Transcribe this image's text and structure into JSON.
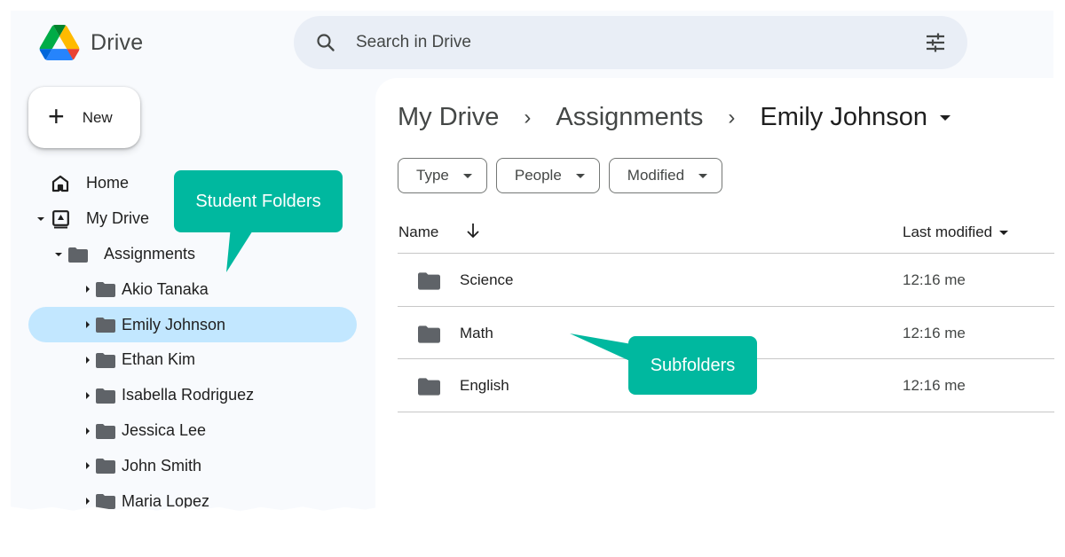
{
  "app": {
    "name": "Drive",
    "logo_icon": "google-drive-logo"
  },
  "search": {
    "placeholder": "Search in Drive",
    "search_icon": "search-icon",
    "options_icon": "tune-icon"
  },
  "new_button": {
    "label": "New",
    "icon": "plus-icon"
  },
  "sidebar": {
    "items": [
      {
        "label": "Home",
        "icon": "home-icon",
        "depth": 0,
        "caret": "none",
        "selected": false
      },
      {
        "label": "My Drive",
        "icon": "my-drive-icon",
        "depth": 0,
        "caret": "expanded",
        "selected": false
      },
      {
        "label": "Assignments",
        "icon": "folder-icon",
        "depth": 1,
        "caret": "expanded",
        "selected": false
      },
      {
        "label": "Akio Tanaka",
        "icon": "folder-icon",
        "depth": 2,
        "caret": "collapsed",
        "selected": false
      },
      {
        "label": "Emily Johnson",
        "icon": "folder-icon",
        "depth": 2,
        "caret": "collapsed",
        "selected": true
      },
      {
        "label": "Ethan Kim",
        "icon": "folder-icon",
        "depth": 2,
        "caret": "collapsed",
        "selected": false
      },
      {
        "label": "Isabella Rodriguez",
        "icon": "folder-icon",
        "depth": 2,
        "caret": "collapsed",
        "selected": false
      },
      {
        "label": "Jessica Lee",
        "icon": "folder-icon",
        "depth": 2,
        "caret": "collapsed",
        "selected": false
      },
      {
        "label": "John Smith",
        "icon": "folder-icon",
        "depth": 2,
        "caret": "collapsed",
        "selected": false
      },
      {
        "label": "Maria Lopez",
        "icon": "folder-icon",
        "depth": 2,
        "caret": "collapsed",
        "selected": false
      }
    ]
  },
  "breadcrumb": {
    "items": [
      "My Drive",
      "Assignments",
      "Emily Johnson"
    ],
    "separator": "›"
  },
  "filters": {
    "chips": [
      "Type",
      "People",
      "Modified"
    ]
  },
  "file_list": {
    "columns": {
      "name": "Name",
      "name_sort": "descending",
      "last_modified": "Last modified"
    },
    "rows": [
      {
        "name": "Science",
        "type": "folder",
        "last_modified": "12:16 me"
      },
      {
        "name": "Math",
        "type": "folder",
        "last_modified": "12:16 me"
      },
      {
        "name": "English",
        "type": "folder",
        "last_modified": "12:16 me"
      }
    ]
  },
  "annotations": {
    "student_folders": "Student Folders",
    "subfolders": "Subfolders",
    "color": "#00b89f"
  },
  "colors": {
    "frame_bg": "#f8fafd",
    "search_bg": "#e9eef6",
    "selected_bg": "#c2e7ff",
    "folder_icon": "#5f6368",
    "text_primary": "#1f1f1f",
    "text_secondary": "#444746"
  }
}
